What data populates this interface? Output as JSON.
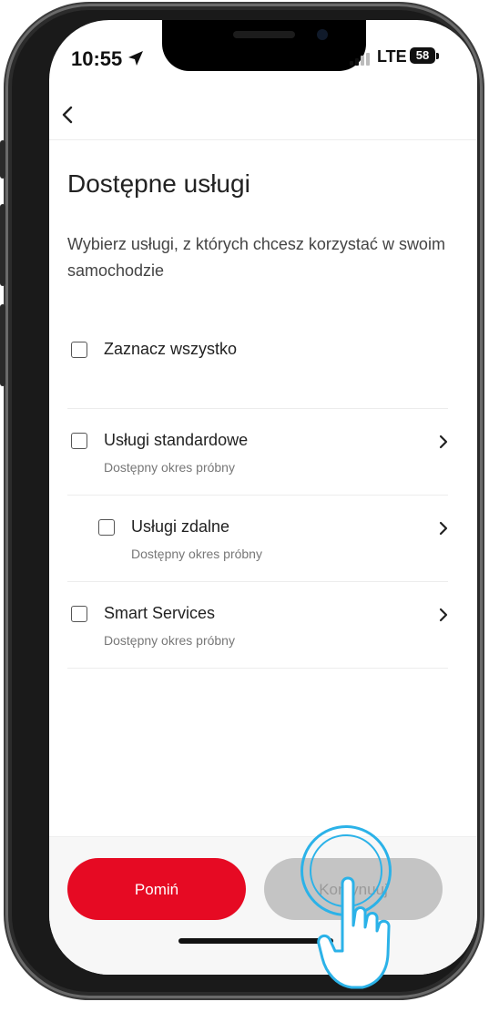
{
  "status_bar": {
    "time": "10:55",
    "network": "LTE",
    "battery": "58"
  },
  "page": {
    "title": "Dostępne usługi",
    "description": "Wybierz usługi, z których chcesz korzystać w swoim samochodzie"
  },
  "services": {
    "select_all": {
      "label": "Zaznacz wszystko",
      "checked": false
    },
    "items": [
      {
        "label": "Usługi standardowe",
        "subtitle": "Dostępny okres próbny",
        "checked": false
      },
      {
        "label": "Usługi zdalne",
        "subtitle": "Dostępny okres próbny",
        "checked": false
      },
      {
        "label": "Smart Services",
        "subtitle": "Dostępny okres próbny",
        "checked": false
      }
    ]
  },
  "actions": {
    "skip_label": "Pomiń",
    "continue_label": "Kontynuuj"
  },
  "colors": {
    "accent": "#e60a23",
    "disabled_button": "#c4c4c4",
    "tap_highlight": "#2bb2e8"
  },
  "icons": [
    "location-arrow-icon",
    "signal-bars-icon",
    "battery-icon",
    "back-chevron-icon",
    "chevron-right-icon",
    "checkbox-icon",
    "tap-hand-icon"
  ]
}
